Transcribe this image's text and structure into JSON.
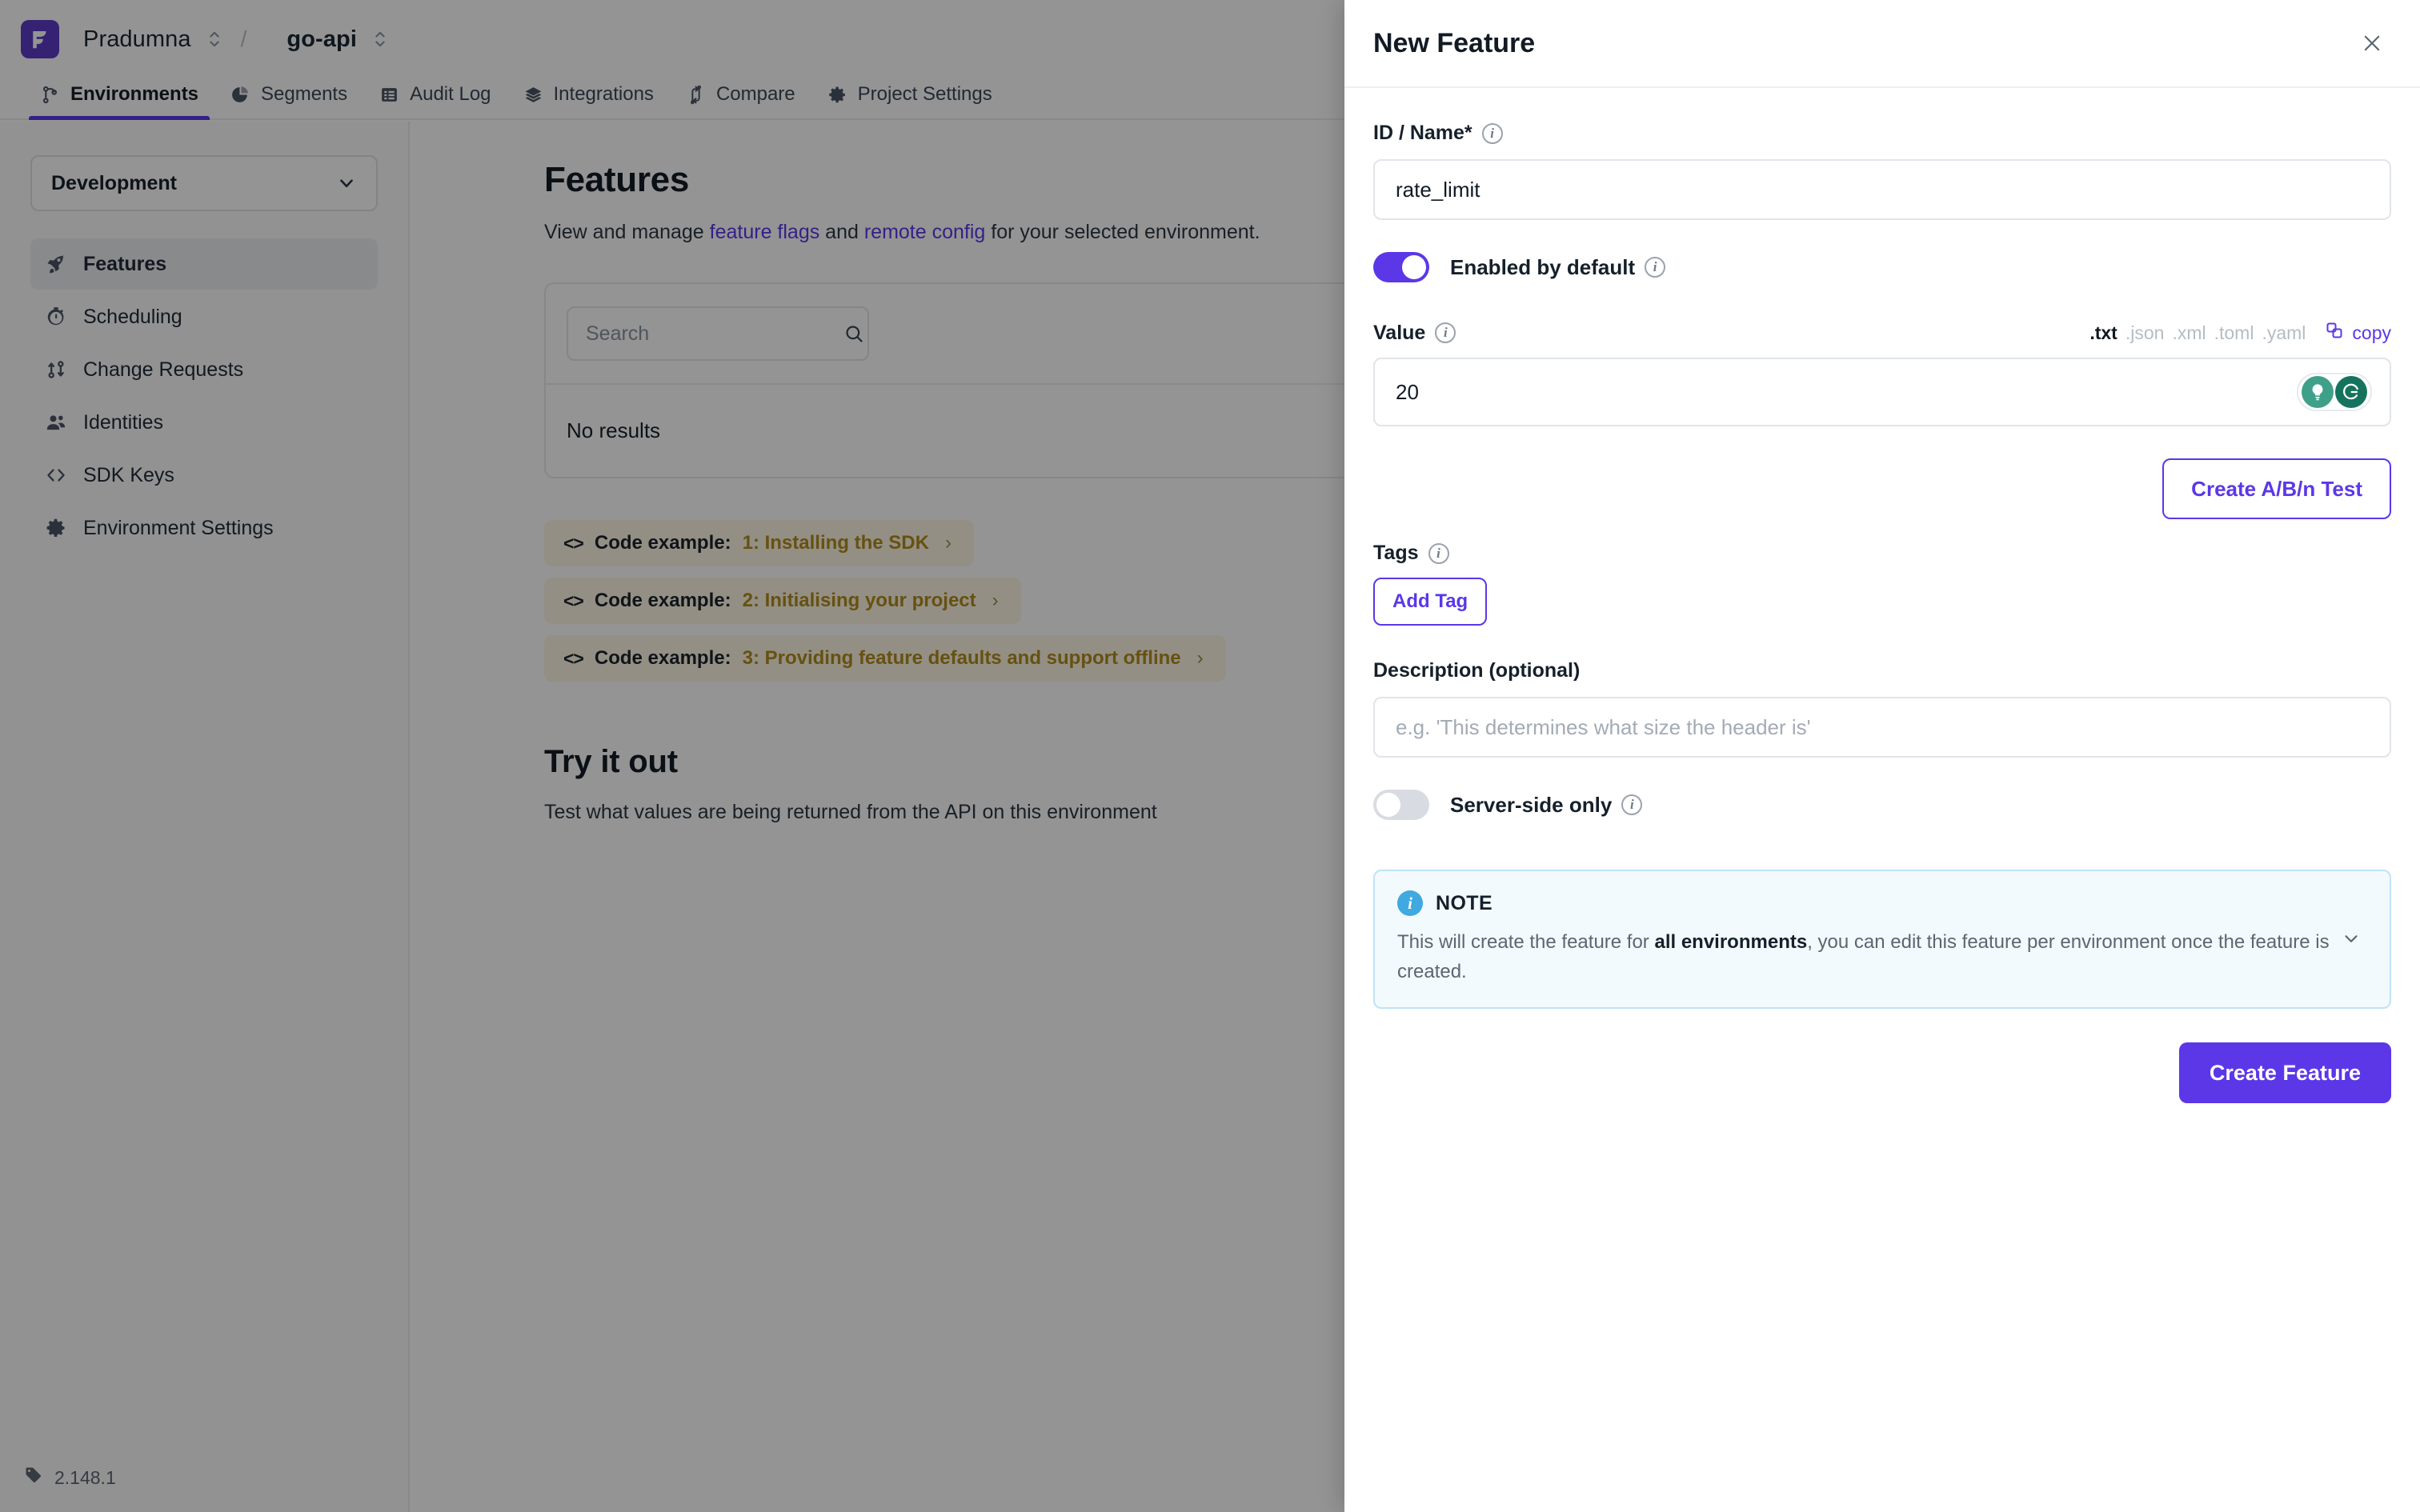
{
  "topbar": {
    "logo_icon": "flagsmith-logo-icon",
    "organisation": "Pradumna",
    "separator": "/",
    "project": "go-api",
    "org_switch_icon": "chevron-updown-icon",
    "project_switch_icon": "chevron-updown-icon"
  },
  "nav": {
    "tabs": [
      {
        "label": "Environments",
        "icon": "branch-icon",
        "active": true
      },
      {
        "label": "Segments",
        "icon": "pie-chart-icon",
        "active": false
      },
      {
        "label": "Audit Log",
        "icon": "list-icon",
        "active": false
      },
      {
        "label": "Integrations",
        "icon": "layers-icon",
        "active": false
      },
      {
        "label": "Compare",
        "icon": "compare-icon",
        "active": false
      },
      {
        "label": "Project Settings",
        "icon": "gear-icon",
        "active": false
      }
    ]
  },
  "sidebar": {
    "environment_selected": "Development",
    "environment_chevron_icon": "chevron-down-icon",
    "items": [
      {
        "label": "Features",
        "icon": "rocket-icon",
        "active": true
      },
      {
        "label": "Scheduling",
        "icon": "stopwatch-icon",
        "active": false
      },
      {
        "label": "Change Requests",
        "icon": "change-request-icon",
        "active": false
      },
      {
        "label": "Identities",
        "icon": "people-icon",
        "active": false
      },
      {
        "label": "SDK Keys",
        "icon": "code-brackets-icon",
        "active": false
      },
      {
        "label": "Environment Settings",
        "icon": "gear-icon",
        "active": false
      }
    ],
    "version": "2.148.1",
    "version_icon": "tag-icon"
  },
  "main": {
    "title": "Features",
    "subtitle_part1": "View and manage ",
    "subtitle_link1": "feature flags",
    "subtitle_part2": " and ",
    "subtitle_link2": "remote config",
    "subtitle_part3": " for your selected environment.",
    "search_placeholder": "Search",
    "search_value": "",
    "search_icon": "search-icon",
    "no_results": "No results",
    "code_examples": [
      {
        "prefix": "Code example:",
        "title": "1: Installing the SDK",
        "icon": "code-brackets-icon",
        "arrow": "›"
      },
      {
        "prefix": "Code example:",
        "title": "2: Initialising your project",
        "icon": "code-brackets-icon",
        "arrow": "›"
      },
      {
        "prefix": "Code example:",
        "title": "3: Providing feature defaults and support offline",
        "icon": "code-brackets-icon",
        "arrow": "›"
      }
    ],
    "tryit_title": "Try it out",
    "tryit_subtitle": "Test what values are being returned from the API on this environment"
  },
  "panel": {
    "title": "New Feature",
    "close_icon": "close-icon",
    "id_name_label": "ID / Name*",
    "id_name_value": "rate_limit",
    "id_name_info_icon": "info-icon",
    "enabled_label": "Enabled by default",
    "enabled_state": "on",
    "enabled_info_icon": "info-icon",
    "value_label": "Value",
    "value_info_icon": "info-icon",
    "value_current": "20",
    "formats": [
      {
        "label": ".txt",
        "selected": true
      },
      {
        "label": ".json",
        "selected": false
      },
      {
        "label": ".xml",
        "selected": false
      },
      {
        "label": ".toml",
        "selected": false
      },
      {
        "label": ".yaml",
        "selected": false
      }
    ],
    "copy_label": "copy",
    "copy_icon": "copy-icon",
    "grammarly_assist_icon": "grammarly-bulb-icon",
    "grammarly_icon": "grammarly-g-icon",
    "ab_test_button": "Create A/B/n Test",
    "tags_label": "Tags",
    "tags_info_icon": "info-icon",
    "add_tag_button": "Add Tag",
    "description_label": "Description (optional)",
    "description_placeholder": "e.g. 'This determines what size the header is'",
    "description_value": "",
    "server_side_label": "Server-side only",
    "server_side_state": "off",
    "server_side_info_icon": "info-icon",
    "note_icon": "info-circle-icon",
    "note_title": "NOTE",
    "note_text_part1": "This will create the feature for ",
    "note_text_bold": "all environments",
    "note_text_part2": ", you can edit this feature per environment once the feature is created.",
    "note_chevron_icon": "chevron-down-icon",
    "create_button": "Create Feature"
  },
  "colors": {
    "accent": "#5b37e8",
    "logo": "#5d3cc4",
    "code_example_bg": "#fdf6e3",
    "code_example_text": "#b08c1e",
    "note_bg": "#f2fafd",
    "note_border": "#bfe3f5",
    "note_icon_bg": "#3fa9e0"
  }
}
